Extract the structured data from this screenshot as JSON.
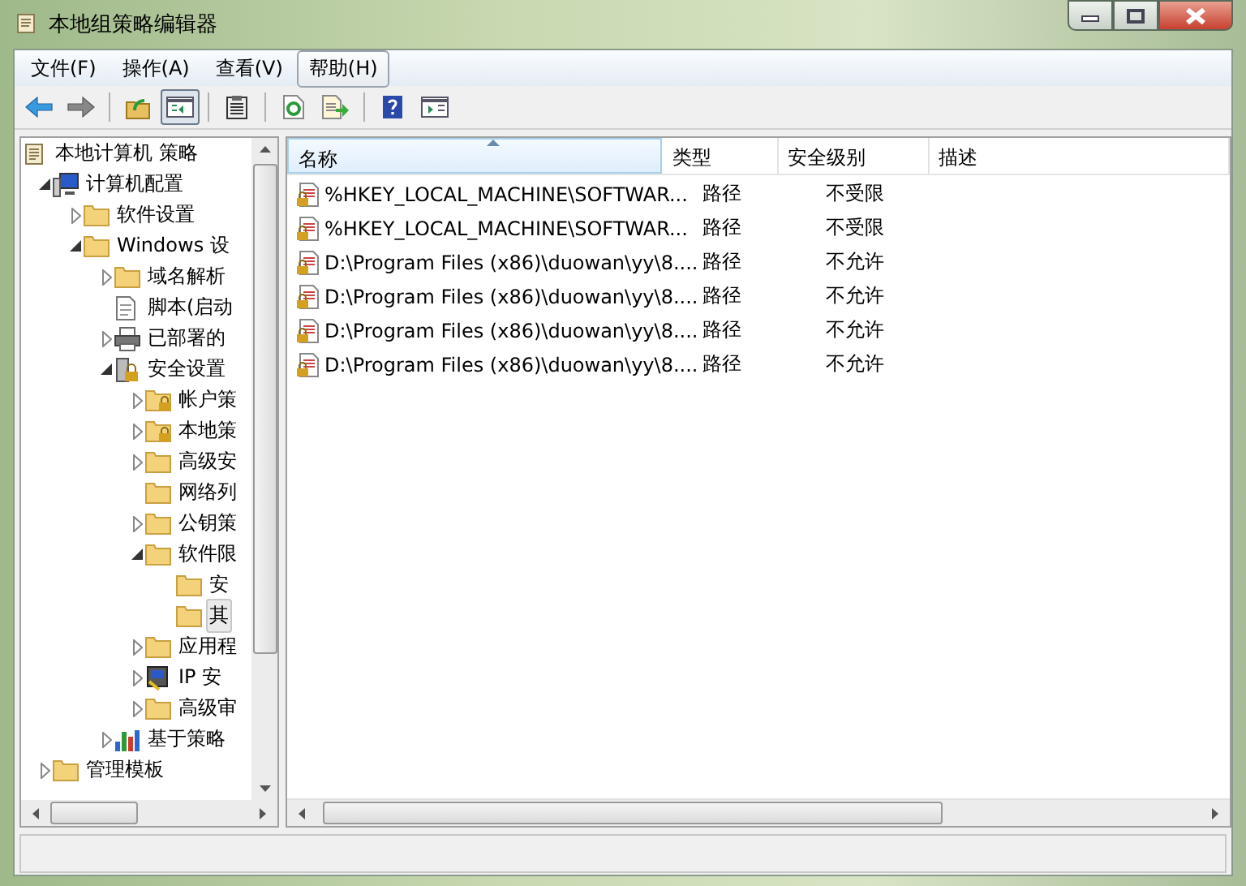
{
  "window": {
    "title": "本地组策略编辑器"
  },
  "menu": [
    {
      "label": "文件(F)",
      "selected": false
    },
    {
      "label": "操作(A)",
      "selected": false
    },
    {
      "label": "查看(V)",
      "selected": false
    },
    {
      "label": "帮助(H)",
      "selected": true
    }
  ],
  "toolbar": [
    {
      "kind": "back",
      "disabled": false
    },
    {
      "kind": "forward",
      "disabled": true
    },
    {
      "kind": "sep"
    },
    {
      "kind": "up"
    },
    {
      "kind": "tree",
      "pressed": true
    },
    {
      "kind": "sep"
    },
    {
      "kind": "clipboard"
    },
    {
      "kind": "sep"
    },
    {
      "kind": "refresh"
    },
    {
      "kind": "export"
    },
    {
      "kind": "sep"
    },
    {
      "kind": "help"
    },
    {
      "kind": "pane"
    }
  ],
  "tree": [
    {
      "label": "本地计算机 策略",
      "kind": "policy",
      "leaf": true,
      "selected": false,
      "children": [
        {
          "label": "计算机配置",
          "kind": "computer",
          "leaf": false,
          "expanded": true,
          "selected": false,
          "children": [
            {
              "label": "软件设置",
              "kind": "folder",
              "leaf": false,
              "expanded": false,
              "selected": false
            },
            {
              "label": "Windows 设",
              "kind": "folder",
              "leaf": false,
              "expanded": true,
              "selected": false,
              "children": [
                {
                  "label": "域名解析",
                  "kind": "folder",
                  "leaf": false,
                  "expanded": false,
                  "selected": false
                },
                {
                  "label": "脚本(启动",
                  "kind": "script",
                  "leaf": true,
                  "selected": false
                },
                {
                  "label": "已部署的",
                  "kind": "printer",
                  "leaf": false,
                  "expanded": false,
                  "selected": false
                },
                {
                  "label": "安全设置",
                  "kind": "lock",
                  "leaf": false,
                  "expanded": true,
                  "selected": false,
                  "children": [
                    {
                      "label": "帐户策",
                      "kind": "lockfolder",
                      "leaf": false,
                      "expanded": false,
                      "selected": false
                    },
                    {
                      "label": "本地策",
                      "kind": "lockfolder",
                      "leaf": false,
                      "expanded": false,
                      "selected": false
                    },
                    {
                      "label": "高级安",
                      "kind": "folder",
                      "leaf": false,
                      "expanded": false,
                      "selected": false
                    },
                    {
                      "label": "网络列",
                      "kind": "folder",
                      "leaf": true,
                      "selected": false
                    },
                    {
                      "label": "公钥策",
                      "kind": "folder",
                      "leaf": false,
                      "expanded": false,
                      "selected": false
                    },
                    {
                      "label": "软件限",
                      "kind": "folder",
                      "leaf": false,
                      "expanded": true,
                      "selected": false,
                      "children": [
                        {
                          "label": "安",
                          "kind": "folder",
                          "leaf": true,
                          "selected": false
                        },
                        {
                          "label": "其",
                          "kind": "folder",
                          "leaf": true,
                          "selected": true
                        }
                      ]
                    },
                    {
                      "label": "应用程",
                      "kind": "folder",
                      "leaf": false,
                      "expanded": false,
                      "selected": false
                    },
                    {
                      "label": "IP 安",
                      "kind": "ipsec",
                      "leaf": false,
                      "expanded": false,
                      "selected": false
                    },
                    {
                      "label": "高级审",
                      "kind": "folder",
                      "leaf": false,
                      "expanded": false,
                      "selected": false
                    }
                  ]
                },
                {
                  "label": "基于策略",
                  "kind": "chart",
                  "leaf": false,
                  "expanded": false,
                  "selected": false
                }
              ]
            }
          ]
        },
        {
          "label": "管理模板",
          "kind": "folder",
          "leaf": false,
          "expanded": false,
          "selected": false
        }
      ]
    }
  ],
  "table": {
    "columns": [
      {
        "label": "名称",
        "sorted": true
      },
      {
        "label": "类型",
        "sorted": false
      },
      {
        "label": "安全级别",
        "sorted": false
      },
      {
        "label": "描述",
        "sorted": false
      }
    ],
    "rows": [
      {
        "name": "%HKEY_LOCAL_MACHINE\\SOFTWAR...",
        "type": "路径",
        "level": "不受限"
      },
      {
        "name": "%HKEY_LOCAL_MACHINE\\SOFTWAR...",
        "type": "路径",
        "level": "不受限"
      },
      {
        "name": "D:\\Program Files (x86)\\duowan\\yy\\8....",
        "type": "路径",
        "level": "不允许"
      },
      {
        "name": "D:\\Program Files (x86)\\duowan\\yy\\8....",
        "type": "路径",
        "level": "不允许"
      },
      {
        "name": "D:\\Program Files (x86)\\duowan\\yy\\8....",
        "type": "路径",
        "level": "不允许"
      },
      {
        "name": "D:\\Program Files (x86)\\duowan\\yy\\8....",
        "type": "路径",
        "level": "不允许"
      }
    ]
  }
}
